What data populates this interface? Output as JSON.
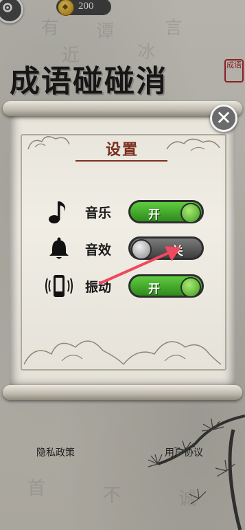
{
  "header": {
    "coin_count": "200",
    "settings_icon": "gear-icon",
    "coin_icon": "coin-icon"
  },
  "game_title": "成语碰碰消",
  "seal_text": "成语",
  "settings_dialog": {
    "title": "设置",
    "close_icon": "close-icon",
    "rows": [
      {
        "icon": "music-note-icon",
        "label": "音乐",
        "toggle_text": "开",
        "state": "on"
      },
      {
        "icon": "bell-icon",
        "label": "音效",
        "toggle_text": "关",
        "state": "off"
      },
      {
        "icon": "phone-vibrate-icon",
        "label": "振动",
        "toggle_text": "开",
        "state": "on"
      }
    ]
  },
  "annotation_arrow": "red-arrow-icon",
  "footer": {
    "privacy_link": "隐私政策",
    "user_agreement_link": "用户协议"
  },
  "colors": {
    "toggle_on": "#3fa82a",
    "toggle_off": "#5a5a5a",
    "title_red": "#7a2f1f",
    "arrow": "#f0485f"
  }
}
